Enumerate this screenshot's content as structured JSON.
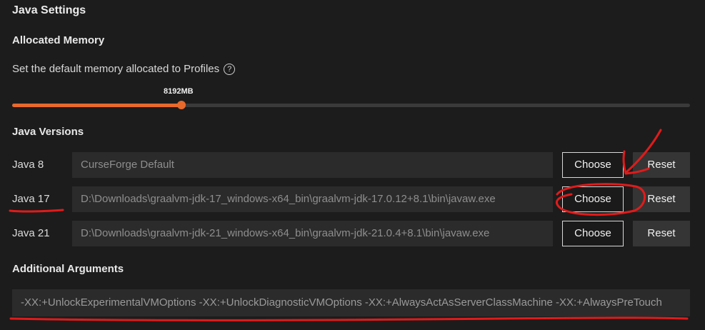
{
  "section_title": "Java Settings",
  "memory": {
    "title": "Allocated Memory",
    "description": "Set the default memory allocated to Profiles",
    "help_icon": "?",
    "value_label": "8192MB",
    "fill_fraction": 0.25,
    "accent_color": "#e8692c"
  },
  "versions": {
    "title": "Java Versions",
    "rows": [
      {
        "label": "Java 8",
        "path": "CurseForge Default",
        "choose": "Choose",
        "reset": "Reset"
      },
      {
        "label": "Java 17",
        "path": "D:\\Downloads\\graalvm-jdk-17_windows-x64_bin\\graalvm-jdk-17.0.12+8.1\\bin\\javaw.exe",
        "choose": "Choose",
        "reset": "Reset"
      },
      {
        "label": "Java 21",
        "path": "D:\\Downloads\\graalvm-jdk-21_windows-x64_bin\\graalvm-jdk-21.0.4+8.1\\bin\\javaw.exe",
        "choose": "Choose",
        "reset": "Reset"
      }
    ]
  },
  "arguments": {
    "title": "Additional Arguments",
    "value": "-XX:+UnlockExperimentalVMOptions -XX:+UnlockDiagnosticVMOptions -XX:+AlwaysActAsServerClassMachine -XX:+AlwaysPreTouch"
  },
  "annotation_color": "#e01b1b"
}
